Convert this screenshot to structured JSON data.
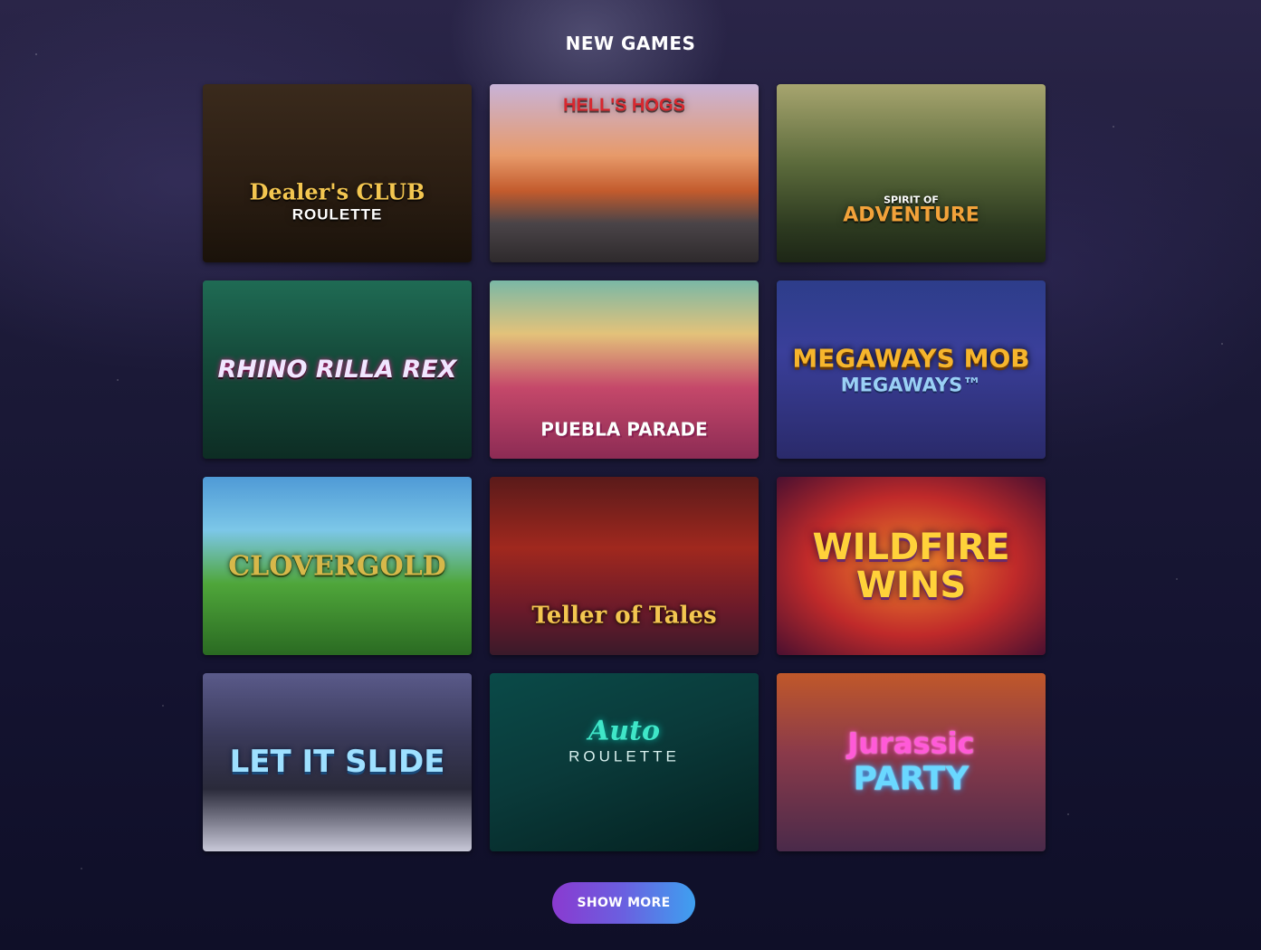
{
  "section": {
    "title": "NEW GAMES"
  },
  "games": [
    {
      "title": "Dealer's CLUB",
      "subtitle": "ROULETTE"
    },
    {
      "title": "HELL'S HOGS",
      "subtitle": ""
    },
    {
      "title": "ADVENTURE",
      "subtitle": "SPIRIT OF"
    },
    {
      "title": "RHINO RILLA REX",
      "subtitle": ""
    },
    {
      "title": "PUEBLA PARADE",
      "subtitle": ""
    },
    {
      "title": "MEGAWAYS MOB",
      "subtitle": "MEGAWAYS™"
    },
    {
      "title": "CLOVERGOLD",
      "subtitle": ""
    },
    {
      "title": "Teller of Tales",
      "subtitle": ""
    },
    {
      "title": "WILDFIRE WINS",
      "subtitle": ""
    },
    {
      "title": "LET IT SLIDE",
      "subtitle": ""
    },
    {
      "title": "Auto",
      "subtitle": "ROULETTE"
    },
    {
      "title": "Jurassic",
      "subtitle": "PARTY"
    }
  ],
  "actions": {
    "show_more_label": "SHOW MORE"
  }
}
